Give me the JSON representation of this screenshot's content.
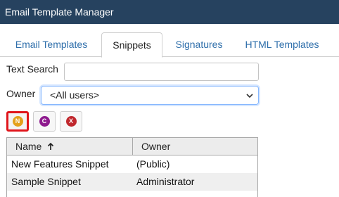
{
  "app": {
    "title": "Email Template Manager"
  },
  "tabs": [
    {
      "label": "Email Templates",
      "active": false
    },
    {
      "label": "Snippets",
      "active": true
    },
    {
      "label": "Signatures",
      "active": false
    },
    {
      "label": "HTML Templates",
      "active": false
    }
  ],
  "filters": {
    "text_search_label": "Text Search",
    "text_search_value": "",
    "owner_label": "Owner",
    "owner_selected": "<All users>"
  },
  "toolbar": {
    "buttons": [
      {
        "letter": "N",
        "icon": "new-icon",
        "color": "#e4a11b",
        "selected": true
      },
      {
        "letter": "C",
        "icon": "copy-icon",
        "color": "#8e1a8e",
        "selected": false
      },
      {
        "letter": "X",
        "icon": "delete-icon",
        "color": "#c0282d",
        "selected": false
      }
    ]
  },
  "grid": {
    "columns": [
      {
        "label": "Name",
        "sort": "ascending",
        "sort_icon": "sort-up-arrow-icon"
      },
      {
        "label": "Owner"
      }
    ],
    "rows": [
      {
        "name": "New Features Snippet",
        "owner": "(Public)"
      },
      {
        "name": "Sample Snippet",
        "owner": "Administrator"
      }
    ]
  }
}
